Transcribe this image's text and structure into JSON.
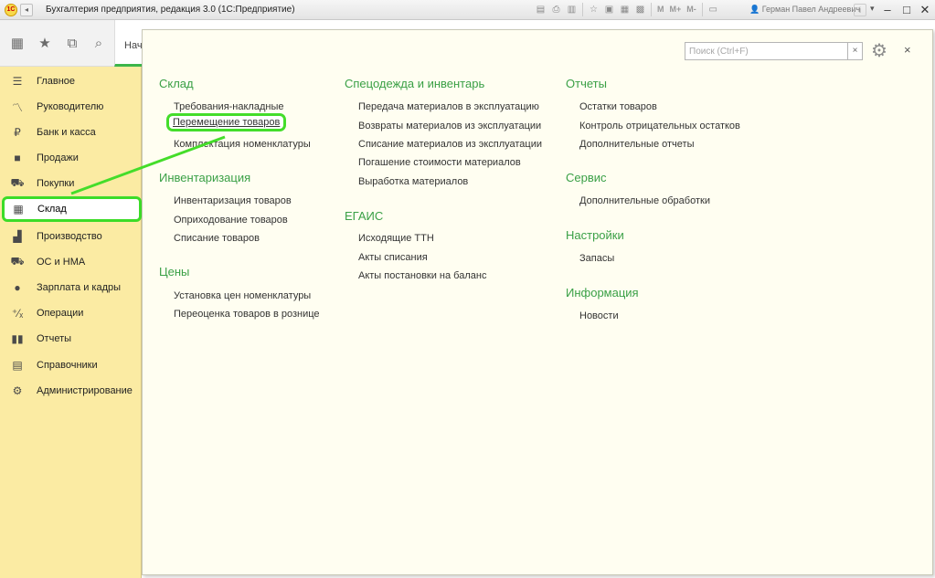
{
  "window": {
    "title": "Бухгалтерия предприятия, редакция 3.0  (1С:Предприятие)",
    "logo": "1С",
    "user": "Герман Павел Андреевич",
    "toolbar_m": [
      "M",
      "M+",
      "M-"
    ]
  },
  "tabs": {
    "start": "Начальная страница"
  },
  "sidebar": {
    "items": [
      {
        "label": "Главное",
        "icon": "menu-lines-icon"
      },
      {
        "label": "Руководителю",
        "icon": "trend-icon"
      },
      {
        "label": "Банк и касса",
        "icon": "ruble-icon"
      },
      {
        "label": "Продажи",
        "icon": "bag-icon"
      },
      {
        "label": "Покупки",
        "icon": "cart-icon"
      },
      {
        "label": "Склад",
        "icon": "warehouse-icon"
      },
      {
        "label": "Производство",
        "icon": "factory-icon"
      },
      {
        "label": "ОС и НМА",
        "icon": "truck-icon"
      },
      {
        "label": "Зарплата и кадры",
        "icon": "person-icon"
      },
      {
        "label": "Операции",
        "icon": "operations-icon"
      },
      {
        "label": "Отчеты",
        "icon": "bar-chart-icon"
      },
      {
        "label": "Справочники",
        "icon": "book-icon"
      },
      {
        "label": "Администрирование",
        "icon": "gear-icon"
      }
    ],
    "active": "Склад"
  },
  "search": {
    "placeholder": "Поиск (Ctrl+F)",
    "clear": "×"
  },
  "close_label": "×",
  "sections": {
    "sklad": {
      "title": "Склад",
      "links": [
        "Требования-накладные",
        "Перемещение товаров",
        "Комплектация номенклатуры"
      ]
    },
    "inventory": {
      "title": "Инвентаризация",
      "links": [
        "Инвентаризация товаров",
        "Оприходование товаров",
        "Списание товаров"
      ]
    },
    "prices": {
      "title": "Цены",
      "links": [
        "Установка цен номенклатуры",
        "Переоценка товаров в рознице"
      ]
    },
    "workwear": {
      "title": "Спецодежда и инвентарь",
      "links": [
        "Передача материалов в эксплуатацию",
        "Возвраты материалов из эксплуатации",
        "Списание материалов из эксплуатации",
        "Погашение стоимости материалов",
        "Выработка материалов"
      ]
    },
    "egais": {
      "title": "ЕГАИС",
      "links": [
        "Исходящие ТТН",
        "Акты списания",
        "Акты постановки на баланс"
      ]
    },
    "reports": {
      "title": "Отчеты",
      "links": [
        "Остатки товаров",
        "Контроль отрицательных остатков",
        "Дополнительные отчеты"
      ]
    },
    "service": {
      "title": "Сервис",
      "links": [
        "Дополнительные обработки"
      ]
    },
    "settings": {
      "title": "Настройки",
      "links": [
        "Запасы"
      ]
    },
    "info": {
      "title": "Информация",
      "links": [
        "Новости"
      ]
    }
  },
  "colors": {
    "sidebar_bg": "#fbeba3",
    "panel_bg": "#fffef1",
    "section_title": "#3aa046",
    "highlight": "#44dd2a"
  }
}
